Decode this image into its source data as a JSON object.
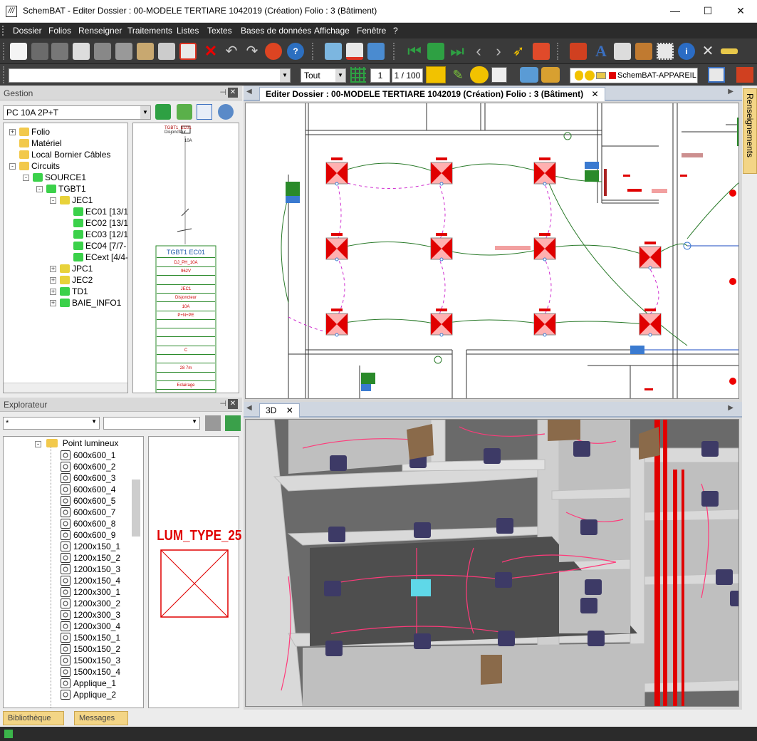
{
  "window": {
    "title": "SchemBAT - Editer  Dossier : 00-MODELE TERTIARE 1042019  (Création)  Folio : 3  (Bâtiment)",
    "minimize": "—",
    "maximize": "☐",
    "close": "✕"
  },
  "menu": [
    "Dossier",
    "Folios",
    "Renseigner",
    "Traitements",
    "Listes",
    "Textes",
    "Bases de données",
    "Affichage",
    "Fenêtre",
    "?"
  ],
  "toolbar2": {
    "filter_value": "Tout",
    "page_current": "1",
    "page_total": "1 / 100",
    "layer_label": "SchemBAT-APPAREIL",
    "layer_color": "#e00000"
  },
  "gestion": {
    "title": "Gestion",
    "circuit_value": "PC 10A 2P+T",
    "tree": [
      {
        "label": "Folio",
        "indent": 0,
        "exp": "+",
        "icon": "db"
      },
      {
        "label": "Matériel",
        "indent": 0,
        "exp": "",
        "icon": "db"
      },
      {
        "label": "Local Bornier Câbles",
        "indent": 0,
        "exp": "",
        "icon": "db"
      },
      {
        "label": "Circuits",
        "indent": 0,
        "exp": "-",
        "icon": "db"
      },
      {
        "label": "SOURCE1",
        "indent": 1,
        "exp": "-",
        "icon": "src"
      },
      {
        "label": "TGBT1",
        "indent": 2,
        "exp": "-",
        "icon": "box"
      },
      {
        "label": "JEC1",
        "indent": 3,
        "exp": "-",
        "icon": "bus"
      },
      {
        "label": "EC01 [13/1",
        "indent": 4,
        "exp": "",
        "icon": "grid"
      },
      {
        "label": "EC02 [13/1",
        "indent": 4,
        "exp": "",
        "icon": "grid"
      },
      {
        "label": "EC03 [12/1",
        "indent": 4,
        "exp": "",
        "icon": "grid"
      },
      {
        "label": "EC04 [7/7-",
        "indent": 4,
        "exp": "",
        "icon": "grid"
      },
      {
        "label": "ECext [4/4-",
        "indent": 4,
        "exp": "",
        "icon": "grid"
      },
      {
        "label": "JPC1",
        "indent": 3,
        "exp": "+",
        "icon": "bus"
      },
      {
        "label": "JEC2",
        "indent": 3,
        "exp": "+",
        "icon": "bus"
      },
      {
        "label": "TD1",
        "indent": 3,
        "exp": "+",
        "icon": "box"
      },
      {
        "label": "BAIE_INFO1",
        "indent": 3,
        "exp": "+",
        "icon": "box"
      }
    ],
    "schema": {
      "header": "TGBT1  EC01",
      "rows": [
        "DJ_PH_10A",
        "962V",
        "",
        "JEC1",
        "Disjoncteur",
        "10A",
        "P+N+PE",
        "",
        "",
        "",
        "C",
        "",
        "28 7m",
        "",
        "Eclairage"
      ],
      "top_label_1": "TGBT1_EC01",
      "top_label_2": "Disjoncteur",
      "top_label_3": "10A"
    }
  },
  "explorateur": {
    "title": "Explorateur",
    "combo1": "*",
    "folder": "Point lumineux",
    "items": [
      "600x600_1",
      "600x600_2",
      "600x600_3",
      "600x600_4",
      "600x600_5",
      "600x600_7",
      "600x600_8",
      "600x600_9",
      "1200x150_1",
      "1200x150_2",
      "1200x150_3",
      "1200x150_4",
      "1200x300_1",
      "1200x300_2",
      "1200x300_3",
      "1200x300_4",
      "1500x150_1",
      "1500x150_2",
      "1500x150_3",
      "1500x150_4",
      "Applique_1",
      "Applique_2"
    ],
    "preview_title": "LUM_TYPE_25"
  },
  "plan_tab": {
    "label": "Editer  Dossier : 00-MODELE TERTIARE 1042019  (Création)  Folio : 3  (Bâtiment)",
    "close": "✕"
  },
  "view3d_tab": {
    "label": "3D",
    "close": "✕"
  },
  "side_tab": "Renseignements",
  "bottom_tabs": [
    "Bibliothèque",
    "Messages"
  ]
}
